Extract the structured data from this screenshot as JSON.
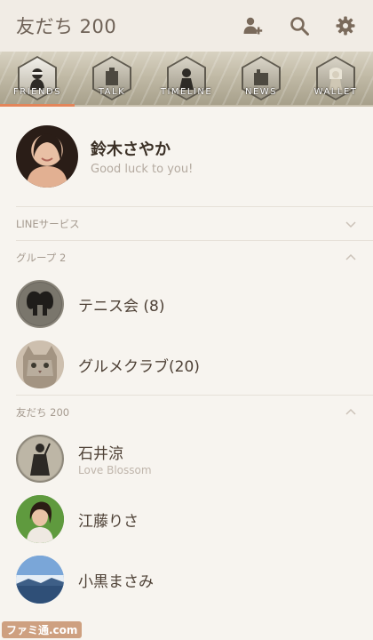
{
  "header": {
    "title": "友だち 200",
    "icons": [
      "add-friend-icon",
      "search-icon",
      "gear-icon"
    ]
  },
  "tabs": [
    {
      "label": "FRIENDS",
      "active": true
    },
    {
      "label": "TALK",
      "active": false
    },
    {
      "label": "TIMELINE",
      "active": false
    },
    {
      "label": "NEWS",
      "active": false
    },
    {
      "label": "WALLET",
      "active": false
    }
  ],
  "profile": {
    "name": "鈴木さやか",
    "status": "Good luck to you!"
  },
  "sections": {
    "line_services": {
      "label": "LINEサービス",
      "state": "collapsed"
    },
    "groups": {
      "label": "グループ 2",
      "state": "expanded"
    },
    "friends": {
      "label": "友だち 200",
      "state": "expanded"
    }
  },
  "groups": [
    {
      "name": "テニス会 (8)"
    },
    {
      "name": "グルメクラブ(20)"
    }
  ],
  "friends": [
    {
      "name": "石井涼",
      "status": "Love Blossom"
    },
    {
      "name": "江藤りさ",
      "status": ""
    },
    {
      "name": "小黒まさみ",
      "status": ""
    }
  ],
  "watermark": "ファミ通.com",
  "colors": {
    "background": "#f7f4ef",
    "header": "#f1ece5",
    "accent": "#e3855a",
    "text": "#4a3d31",
    "muted": "#b4aaa0"
  }
}
